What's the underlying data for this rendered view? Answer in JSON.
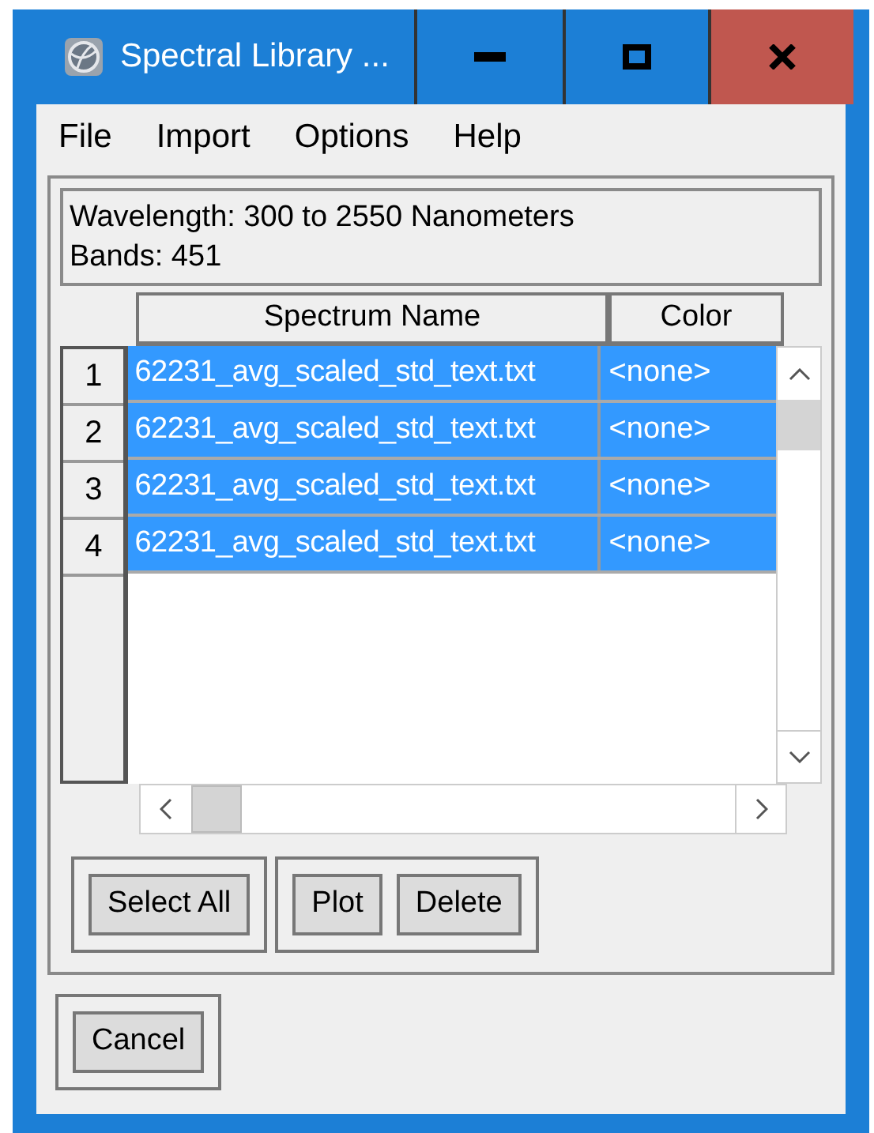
{
  "window": {
    "title": "Spectral Library ..."
  },
  "menu": [
    "File",
    "Import",
    "Options",
    "Help"
  ],
  "info": [
    "Wavelength: 300 to 2550 Nanometers",
    "Bands: 451"
  ],
  "table": {
    "columns": [
      "Spectrum Name",
      "Color"
    ],
    "rows": [
      {
        "number": "1",
        "name": "62231_avg_scaled_std_text.txt",
        "color_cell": "<none>",
        "selected": true
      },
      {
        "number": "2",
        "name": "62231_avg_scaled_std_text.txt",
        "color_cell": "<none>",
        "selected": true
      },
      {
        "number": "3",
        "name": "62231_avg_scaled_std_text.txt",
        "color_cell": "<none>",
        "selected": true
      },
      {
        "number": "4",
        "name": "62231_avg_scaled_std_text.txt",
        "color_cell": "<none>",
        "selected": true
      }
    ]
  },
  "button_groups": [
    [
      "Select All"
    ],
    [
      "Plot",
      "Delete"
    ]
  ],
  "cancel": "Cancel"
}
